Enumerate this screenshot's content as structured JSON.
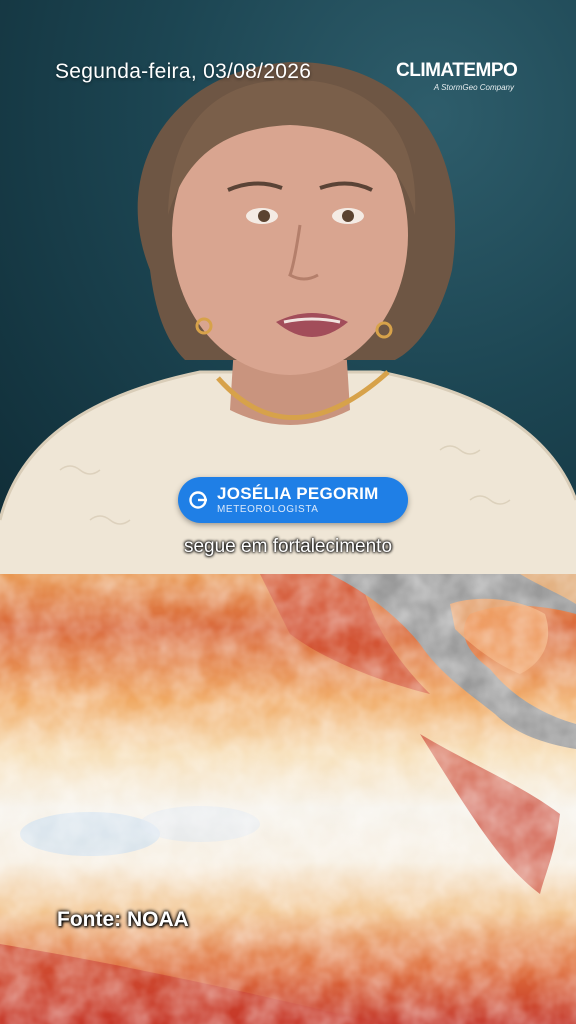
{
  "header": {
    "date": "Segunda-feira, 03/08/2026",
    "brand_name": "CLIMATEMPO",
    "brand_tagline": "A StormGeo Company"
  },
  "presenter": {
    "name": "JOSÉLIA PEGORIM",
    "title": "METEOROLOGISTA"
  },
  "caption": "segue em fortalecimento",
  "map": {
    "source_label": "Fonte: NOAA"
  },
  "colors": {
    "badge_blue": "#1f7fe6",
    "studio_background": "#1c4552",
    "sst_warm": "#d2432a",
    "sst_neutral": "#f6f2ea",
    "sst_cool": "#bcd3ea",
    "land": "#9a9a9a"
  },
  "icons": {
    "brand_mark": "climatempo-logo",
    "badge_mark": "climatempo-icon"
  }
}
